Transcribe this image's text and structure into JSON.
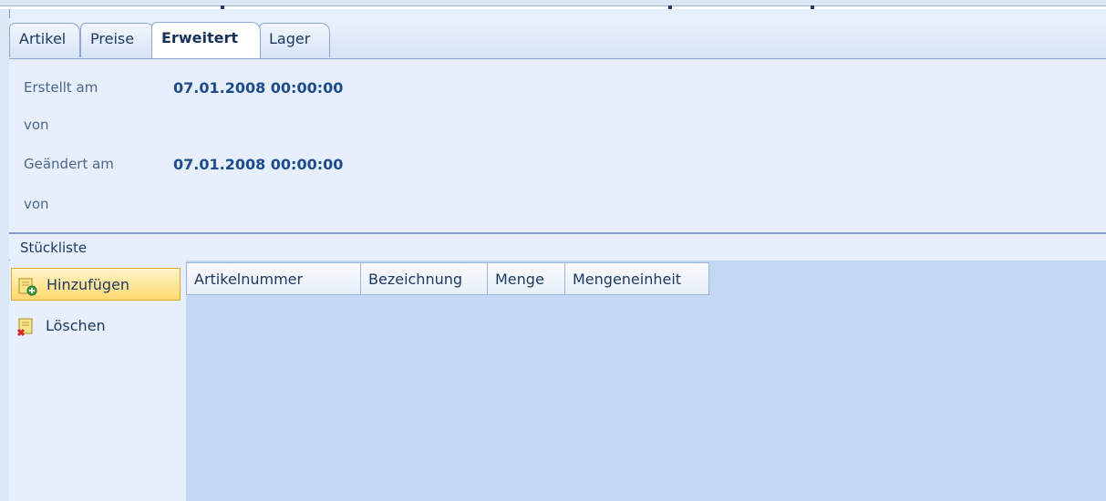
{
  "tabs": [
    {
      "label": "Artikel"
    },
    {
      "label": "Preise"
    },
    {
      "label": "Erweitert"
    },
    {
      "label": "Lager"
    }
  ],
  "info": {
    "created_label": "Erstellt am",
    "created_value": "07.01.2008 00:00:00",
    "created_by_label": "von",
    "changed_label": "Geändert am",
    "changed_value": "07.01.2008 00:00:00",
    "changed_by_label": "von"
  },
  "section": {
    "title": "Stückliste"
  },
  "actions": [
    {
      "label": "Hinzufügen",
      "icon": "add-icon"
    },
    {
      "label": "Löschen",
      "icon": "delete-icon"
    }
  ],
  "grid": {
    "columns": [
      "Artikelnummer",
      "Bezeichnung",
      "Menge",
      "Mengeneinheit"
    ],
    "rows": []
  }
}
